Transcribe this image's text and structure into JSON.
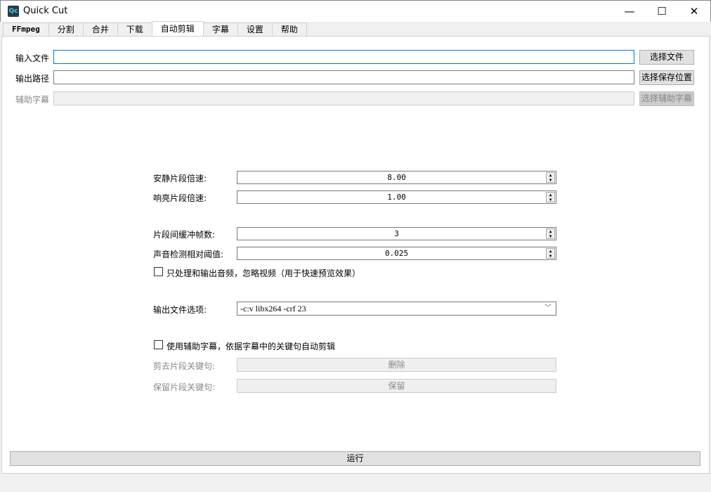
{
  "window": {
    "title": "Quick Cut",
    "icon_text": "Qc",
    "minimize": "—",
    "maximize": "☐",
    "close": "✕"
  },
  "tabs": [
    "FFmpeg",
    "分割",
    "合并",
    "下载",
    "自动剪辑",
    "字幕",
    "设置",
    "帮助"
  ],
  "active_tab": 4,
  "files": {
    "input_label": "输入文件",
    "input_value": "",
    "input_button": "选择文件",
    "output_label": "输出路径",
    "output_value": "",
    "output_button": "选择保存位置",
    "subtitle_label": "辅助字幕",
    "subtitle_value": "",
    "subtitle_button": "选择辅助字幕"
  },
  "form": {
    "quiet_speed_label": "安静片段倍速:",
    "quiet_speed": "8.00",
    "loud_speed_label": "响亮片段倍速:",
    "loud_speed": "1.00",
    "buffer_frames_label": "片段间缓冲帧数:",
    "buffer_frames": "3",
    "threshold_label": "声音检测相对阈值:",
    "threshold": "0.025",
    "audio_only_label": "只处理和输出音频，忽略视频（用于快速预览效果）",
    "audio_only_checked": false,
    "output_options_label": "输出文件选项:",
    "output_options": "-c:v libx264 -crf 23",
    "use_subtitle_label": "使用辅助字幕，依据字幕中的关键句自动剪辑",
    "use_subtitle_checked": false,
    "cut_keyword_label": "剪去片段关键句:",
    "cut_keyword_value": "删除",
    "keep_keyword_label": "保留片段关键句:",
    "keep_keyword_value": "保留"
  },
  "run_button": "运行"
}
